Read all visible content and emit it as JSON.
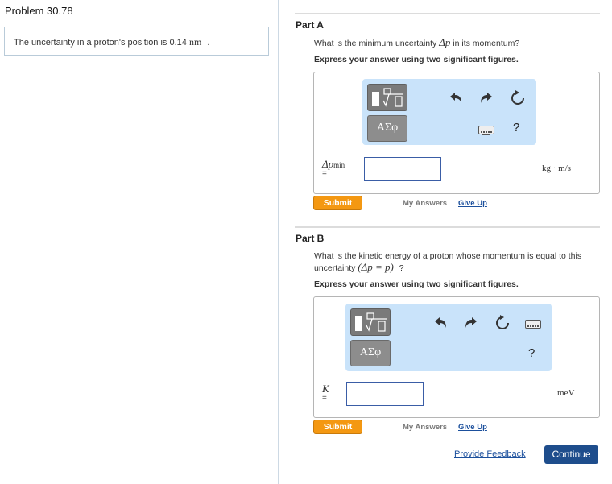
{
  "problem": {
    "title": "Problem 30.78",
    "statement": "The uncertainty in a proton's position is 0.14",
    "statement_unit": "nm",
    "statement_end": "."
  },
  "part_a": {
    "title": "Part A",
    "question_pre": "What is the minimum uncertainty",
    "question_math": "Δp",
    "question_post": "in its momentum?",
    "instruction": "Express your answer using two significant figures.",
    "toolbar": {
      "template_label": "▮√☐",
      "greek_label": "ΑΣφ",
      "help_label": "?"
    },
    "var_label": "Δp",
    "var_sub": "min",
    "equals": "=",
    "input_value": "",
    "unit": "kg · m/s",
    "submit": "Submit",
    "my_answers": "My Answers",
    "give_up": "Give Up"
  },
  "part_b": {
    "title": "Part B",
    "question_pre": "What is the kinetic energy of a proton whose momentum is equal to this uncertainty",
    "question_math": "(Δp = p)",
    "question_post": "?",
    "instruction": "Express your answer using two significant figures.",
    "toolbar": {
      "template_label": "▮√☐",
      "greek_label": "ΑΣφ",
      "help_label": "?"
    },
    "var_label": "K",
    "equals": "=",
    "input_value": "",
    "unit": "meV",
    "submit": "Submit",
    "my_answers": "My Answers",
    "give_up": "Give Up"
  },
  "footer": {
    "feedback": "Provide Feedback",
    "continue": "Continue"
  },
  "colors": {
    "accent_blue": "#1e4d8c",
    "submit_orange": "#f49812",
    "toolbar_bg": "#c9e3fa"
  }
}
